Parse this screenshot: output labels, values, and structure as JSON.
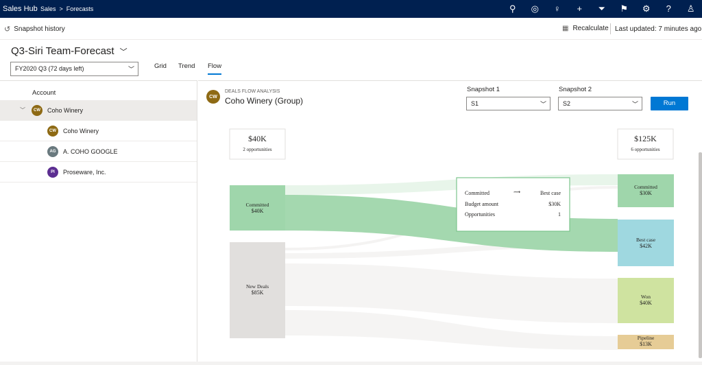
{
  "nav": {
    "app": "Sales Hub",
    "crumb1": "Sales",
    "crumb_sep": ">",
    "crumb2": "Forecasts",
    "icons": [
      "search-icon",
      "target-icon",
      "lightbulb-icon",
      "plus-icon",
      "filter-icon",
      "assistant-icon",
      "settings-icon",
      "help-icon",
      "user-icon"
    ]
  },
  "cmd": {
    "snapshot_history": "Snapshot history",
    "recalculate": "Recalculate",
    "last_updated": "Last updated: 7 minutes ago"
  },
  "header": {
    "title": "Q3-Siri Team-Forecast",
    "period": "FY2020 Q3 (72 days left)",
    "tabs": [
      "Grid",
      "Trend",
      "Flow"
    ],
    "active_tab": "Flow"
  },
  "tree": {
    "header": "Account",
    "rows": [
      {
        "initials": "CW",
        "name": "Coho Winery",
        "color": "#8e6a14"
      },
      {
        "initials": "CW",
        "name": "Coho Winery",
        "color": "#8e6a14"
      },
      {
        "initials": "AG",
        "name": "A. COHO GOOGLE",
        "color": "#69797e"
      },
      {
        "initials": "PI",
        "name": "Proseware, Inc.",
        "color": "#5c2e91"
      }
    ]
  },
  "panel": {
    "initials": "CW",
    "subtitle": "DEALS FLOW ANALYSIS",
    "group": "Coho Winery (Group)",
    "snapshot1_label": "Snapshot 1",
    "snapshot1_value": "S1",
    "snapshot2_label": "Snapshot 2",
    "snapshot2_value": "S2",
    "run": "Run"
  },
  "flow": {
    "left_total": {
      "amount": "$40K",
      "count": "2 opportunities"
    },
    "right_total": {
      "amount": "$125K",
      "count": "6 opportunities"
    },
    "left_nodes": [
      {
        "name": "Committed",
        "amount": "$40K",
        "color": "#9fd6ab"
      },
      {
        "name": "New Deals",
        "amount": "$85K",
        "color": "#e1dfdd"
      }
    ],
    "right_nodes": [
      {
        "name": "Committed",
        "amount": "$30K",
        "color": "#9fd6ab"
      },
      {
        "name": "Best case",
        "amount": "$42K",
        "color": "#9fd8e0"
      },
      {
        "name": "Won",
        "amount": "$40K",
        "color": "#cfe3a0"
      },
      {
        "name": "Pipeline",
        "amount": "$13K",
        "color": "#e6cc96"
      }
    ],
    "tooltip": {
      "from": "Committed",
      "arrow": "⟿",
      "to": "Best case",
      "budget_label": "Budget amount",
      "budget_value": "$30K",
      "opps_label": "Opportunities",
      "opps_value": "1"
    }
  }
}
